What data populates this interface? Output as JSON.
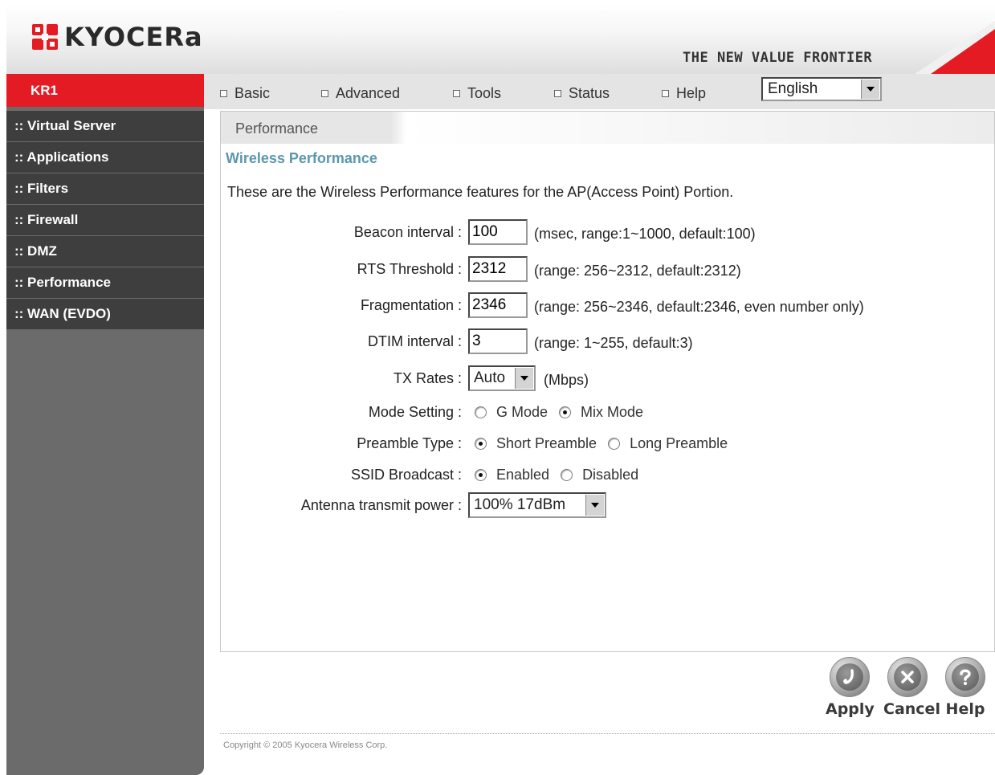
{
  "brand": {
    "logo_text": "KYOCERa",
    "tagline": "THE NEW VALUE FRONTIER",
    "accent_color": "#e41b23"
  },
  "sidebar": {
    "device": "KR1",
    "items": [
      {
        "label": ":: Virtual Server"
      },
      {
        "label": ":: Applications"
      },
      {
        "label": ":: Filters"
      },
      {
        "label": ":: Firewall"
      },
      {
        "label": ":: DMZ"
      },
      {
        "label": ":: Performance"
      },
      {
        "label": ":: WAN (EVDO)"
      }
    ]
  },
  "nav": {
    "items": [
      {
        "label": "Basic"
      },
      {
        "label": "Advanced"
      },
      {
        "label": "Tools"
      },
      {
        "label": "Status"
      },
      {
        "label": "Help"
      }
    ],
    "language": "English"
  },
  "panel": {
    "title": "Performance",
    "section_title": "Wireless Performance",
    "description": "These are the Wireless Performance features for the AP(Access Point) Portion."
  },
  "form": {
    "beacon": {
      "label": "Beacon interval :",
      "value": "100",
      "hint": "(msec, range:1~1000, default:100)"
    },
    "rts": {
      "label": "RTS Threshold :",
      "value": "2312",
      "hint": "(range: 256~2312, default:2312)"
    },
    "frag": {
      "label": "Fragmentation :",
      "value": "2346",
      "hint": "(range: 256~2346, default:2346, even number only)"
    },
    "dtim": {
      "label": "DTIM interval :",
      "value": "3",
      "hint": "(range: 1~255, default:3)"
    },
    "tx": {
      "label": "TX Rates :",
      "value": "Auto",
      "hint": "(Mbps)"
    },
    "mode": {
      "label": "Mode Setting :",
      "option1": "G Mode",
      "option2": "Mix Mode",
      "selected": "Mix Mode"
    },
    "preamble": {
      "label": "Preamble Type :",
      "option1": "Short Preamble",
      "option2": "Long Preamble",
      "selected": "Short Preamble"
    },
    "ssid": {
      "label": "SSID Broadcast :",
      "option1": "Enabled",
      "option2": "Disabled",
      "selected": "Enabled"
    },
    "antenna": {
      "label": "Antenna transmit power :",
      "value": "100% 17dBm"
    }
  },
  "actions": {
    "apply": "Apply",
    "cancel": "Cancel",
    "help": "Help"
  },
  "footer": {
    "copyright": "Copyright © 2005 Kyocera Wireless Corp."
  }
}
